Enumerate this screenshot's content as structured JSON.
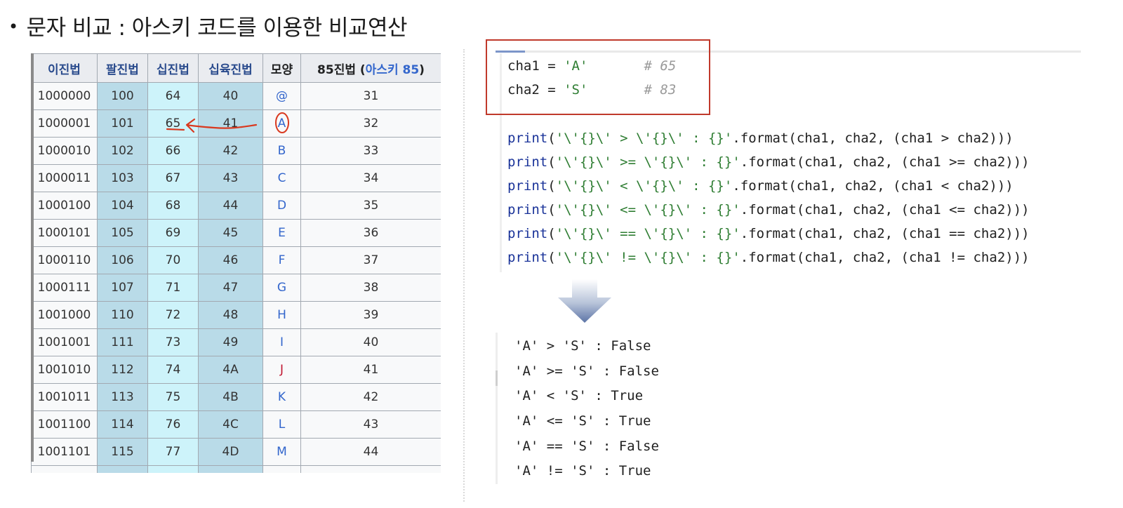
{
  "title": {
    "bullet": "•",
    "text": "문자 비교 : 아스키 코드를 이용한 비교연산"
  },
  "ascii_table": {
    "headers": [
      "이진법",
      "팔진법",
      "십진법",
      "십육진법",
      "모양"
    ],
    "header_b85_prefix": "85진법 (",
    "header_b85_link": "아스키 85",
    "header_b85_suffix": ")",
    "rows": [
      [
        "1000000",
        "100",
        "64",
        "40",
        "@",
        "31"
      ],
      [
        "1000001",
        "101",
        "65",
        "41",
        "A",
        "32"
      ],
      [
        "1000010",
        "102",
        "66",
        "42",
        "B",
        "33"
      ],
      [
        "1000011",
        "103",
        "67",
        "43",
        "C",
        "34"
      ],
      [
        "1000100",
        "104",
        "68",
        "44",
        "D",
        "35"
      ],
      [
        "1000101",
        "105",
        "69",
        "45",
        "E",
        "36"
      ],
      [
        "1000110",
        "106",
        "70",
        "46",
        "F",
        "37"
      ],
      [
        "1000111",
        "107",
        "71",
        "47",
        "G",
        "38"
      ],
      [
        "1001000",
        "110",
        "72",
        "48",
        "H",
        "39"
      ],
      [
        "1001001",
        "111",
        "73",
        "49",
        "I",
        "40"
      ],
      [
        "1001010",
        "112",
        "74",
        "4A",
        "J",
        "41"
      ],
      [
        "1001011",
        "113",
        "75",
        "4B",
        "K",
        "42"
      ],
      [
        "1001100",
        "114",
        "76",
        "4C",
        "L",
        "43"
      ],
      [
        "1001101",
        "115",
        "77",
        "4D",
        "M",
        "44"
      ]
    ]
  },
  "code": {
    "lines": [
      {
        "var": "cha1",
        "op": " = ",
        "str": "'A'",
        "pad": "       ",
        "comment": "# 65"
      },
      {
        "var": "cha2",
        "op": " = ",
        "str": "'S'",
        "pad": "       ",
        "comment": "# 83"
      }
    ],
    "print_lines": [
      {
        "fn": "print",
        "open": "(",
        "str1": "'\\'{}\\' > \\'{}\\' : {}'",
        "rest": ".format(cha1, cha2, (cha1 > cha2)))"
      },
      {
        "fn": "print",
        "open": "(",
        "str1": "'\\'{}\\' >= \\'{}\\' : {}'",
        "rest": ".format(cha1, cha2, (cha1 >= cha2)))"
      },
      {
        "fn": "print",
        "open": "(",
        "str1": "'\\'{}\\' < \\'{}\\' : {}'",
        "rest": ".format(cha1, cha2, (cha1 < cha2)))"
      },
      {
        "fn": "print",
        "open": "(",
        "str1": "'\\'{}\\' <= \\'{}\\' : {}'",
        "rest": ".format(cha1, cha2, (cha1 <= cha2)))"
      },
      {
        "fn": "print",
        "open": "(",
        "str1": "'\\'{}\\' == \\'{}\\' : {}'",
        "rest": ".format(cha1, cha2, (cha1 == cha2)))"
      },
      {
        "fn": "print",
        "open": "(",
        "str1": "'\\'{}\\' != \\'{}\\' : {}'",
        "rest": ".format(cha1, cha2, (cha1 != cha2)))"
      }
    ]
  },
  "output": {
    "lines": [
      "'A' > 'S' : False",
      "'A' >= 'S' : False",
      "'A' < 'S' : True",
      "'A' <= 'S' : True",
      "'A' == 'S' : False",
      "'A' != 'S' : True"
    ]
  },
  "colors": {
    "table_header_text": "#2a4b8d",
    "oct_col": "#b9dbe8",
    "dec_col": "#cdf3fa",
    "shape_text": "#3366cc",
    "highlight_box": "#c0392b",
    "code_string": "#2e7d32",
    "code_function": "#1a3399",
    "code_comment": "#9a9a9a"
  }
}
